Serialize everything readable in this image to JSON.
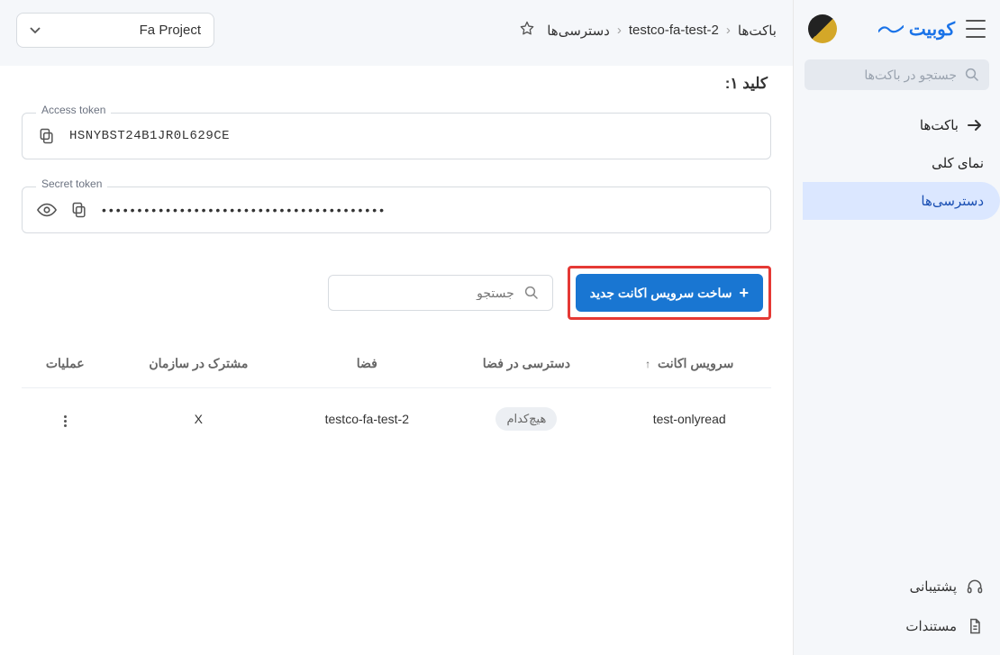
{
  "brand": "کوبیت",
  "sidebar": {
    "search_placeholder": "جستجو در باکت‌ها",
    "items": [
      {
        "label": "باکت‌ها",
        "active": false
      },
      {
        "label": "نمای کلی",
        "active": false
      },
      {
        "label": "دسترسی‌ها",
        "active": true
      }
    ],
    "support": "پشتیبانی",
    "docs": "مستندات"
  },
  "breadcrumb": {
    "root": "باکت‌ها",
    "bucket": "testco-fa-test-2",
    "page": "دسترسی‌ها"
  },
  "project": "Fa Project",
  "keys": {
    "title": "کلید ۱:",
    "access_label": "Access token",
    "access_value": "HSNYBST24B1JR0L629CE",
    "secret_label": "Secret token",
    "secret_mask": "••••••••••••••••••••••••••••••••••••••••"
  },
  "actions": {
    "create_sa": "ساخت سرویس اکانت جدید",
    "search_placeholder": "جستجو"
  },
  "table": {
    "headers": {
      "service_account": "سرویس اکانت",
      "access_in_space": "دسترسی در فضا",
      "space": "فضا",
      "shared_in_org": "مشترک در سازمان",
      "operations": "عملیات"
    },
    "rows": [
      {
        "service_account": "test-onlyread",
        "access_in_space": "هیچ‌کدام",
        "space": "testco-fa-test-2",
        "shared_in_org": "X"
      }
    ]
  }
}
